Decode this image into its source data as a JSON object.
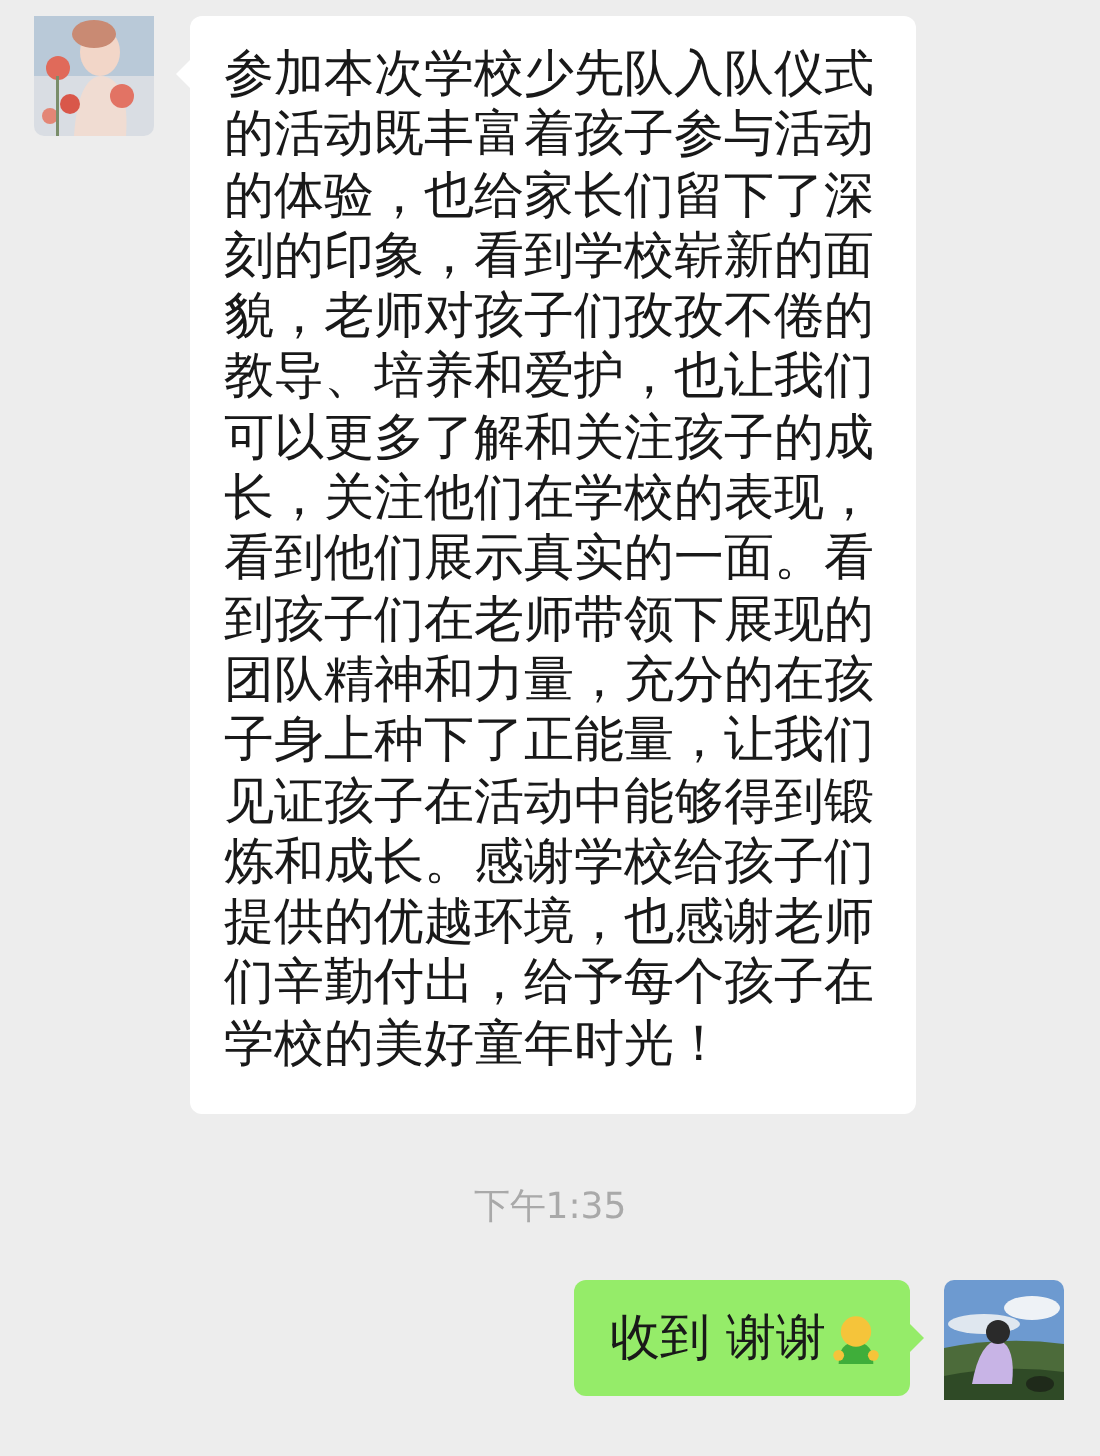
{
  "messages": [
    {
      "kind": "received",
      "text": "参加本次学校少先队入队仪式的活动既丰富着孩子参与活动的体验，也给家长们留下了深刻的印象，看到学校崭新的面貌，老师对孩子们孜孜不倦的教导、培养和爱护，也让我们可以更多了解和关注孩子的成长，关注他们在学校的表现，看到他们展示真实的一面。看到孩子们在老师带领下展现的团队精神和力量，充分的在孩子身上种下了正能量，让我们见证孩子在活动中能够得到锻炼和成长。感谢学校给孩子们提供的优越环境，也感谢老师们辛勤付出，给予每个孩子在学校的美好童年时光！"
    },
    {
      "kind": "time",
      "text": "下午1:35"
    },
    {
      "kind": "sent",
      "text": "收到 谢谢",
      "emoji": true
    }
  ]
}
